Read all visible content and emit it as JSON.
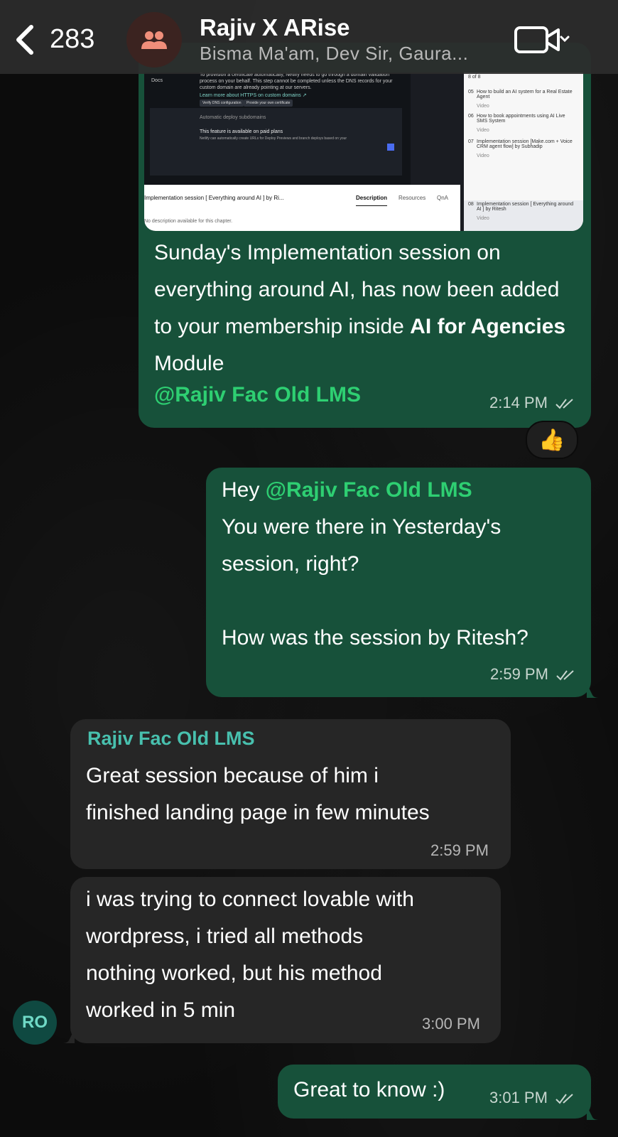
{
  "header": {
    "back_count": "283",
    "title": "Rajiv X ARise",
    "subtitle": "Bisma Ma'am, Dev Sir, Gaura..."
  },
  "messages": [
    {
      "direction": "outgoing",
      "preview": {
        "course_title": "Implementation session [ Everything around AI ] by Ri...",
        "tabs": [
          "Description",
          "Resources",
          "QnA"
        ],
        "description": "No description available for this chapter.",
        "playlist_counter": "8 of 8",
        "playlist": [
          {
            "num": "05",
            "title": "How to build an AI system for a Real Estate Agent",
            "type": "Video"
          },
          {
            "num": "06",
            "title": "How to book appointments using AI Live SMS System",
            "type": "Video"
          },
          {
            "num": "07",
            "title": "Implementation session [Make.com + Voice CRM agent flow] by Subhadip",
            "type": "Video"
          },
          {
            "num": "08",
            "title": "Implementation session [ Everything around AI ] by Ritesh",
            "type": "Video"
          }
        ],
        "dark_lines": [
          "To provision a certificate automatically, Netlify needs to go through a domain validation",
          "process on your behalf. This step cannot be completed unless the DNS records for your",
          "custom domain are already pointing at our servers.",
          "Learn more about HTTPS on custom domains ↗",
          "Automatic deploy subdomains",
          "This feature is available on paid plans",
          "Netlify can automatically create URLs for Deploy Previews and branch deploys based on your"
        ],
        "dark_buttons": [
          "Verify DNS configuration",
          "Provide your own certificate"
        ],
        "dark_side_label": "Docs"
      },
      "text_plain": "Sunday's Implementation session on everything around AI, has now been added to your membership inside ",
      "text_bold": "AI for Agencies",
      "text_after": " Module",
      "mention": "@Rajiv Fac Old LMS",
      "time": "2:14 PM",
      "reaction": "👍"
    },
    {
      "direction": "outgoing",
      "line1_prefix": "Hey ",
      "mention": "@Rajiv Fac Old LMS",
      "line2": "You were there in Yesterday's",
      "line3": "session, right?",
      "line4": "How was the session by Ritesh?",
      "time": "2:59 PM"
    },
    {
      "direction": "incoming",
      "sender": "Rajiv Fac Old LMS",
      "line1": "Great session because of him i",
      "line2": "finished landing page in few minutes",
      "time": "2:59 PM"
    },
    {
      "direction": "incoming",
      "line1": "i was trying to connect lovable with",
      "line2": "wordpress, i tried all methods",
      "line3": "nothing worked, but his method",
      "line4": "worked in 5 min",
      "time": "3:00 PM",
      "avatar_initials": "RO"
    },
    {
      "direction": "outgoing",
      "text": "Great to know :)",
      "time": "3:01 PM"
    }
  ],
  "colors": {
    "outgoing_bubble": "#17513a",
    "incoming_bubble": "#262626",
    "mention": "#2ecf72",
    "sender_name": "#48c0ae"
  },
  "icons": [
    "chevron-left-icon",
    "group-icon",
    "video-camera-icon",
    "chevron-down-icon",
    "double-check-icon",
    "thumbs-up-emoji"
  ]
}
